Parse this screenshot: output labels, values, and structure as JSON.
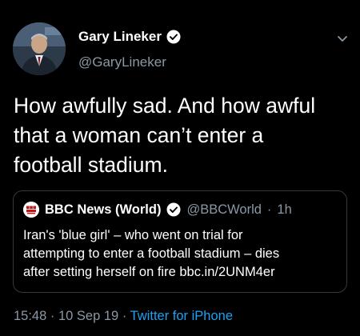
{
  "author": {
    "display_name": "Gary Lineker",
    "handle": "@GaryLineker",
    "verified": true
  },
  "tweet": {
    "text": "How awfully sad. And how awful\nthat a woman can’t enter a\nfootball stadium."
  },
  "quoted_tweet": {
    "display_name": "BBC News (World)",
    "handle": "@BBCWorld",
    "separator": "·",
    "time": "1h",
    "avatar_text": "BBC NEWS WORLD",
    "text": "Iran's 'blue girl' – who went on trial for\nattempting to enter a football stadium – dies\nafter setting herself on fire bbc.in/2UNM4er"
  },
  "meta": {
    "time": "15:48",
    "separator1": "·",
    "date": "10 Sep 19",
    "separator2": "·",
    "source": "Twitter for iPhone"
  },
  "colors": {
    "background": "#000000",
    "primary_text": "#ffffff",
    "secondary_text": "#8b98a5",
    "accent": "#1da1f2",
    "bbc_red": "#bb1919"
  },
  "icons": {
    "verified": "verified-badge-icon",
    "menu": "chevron-down-icon"
  }
}
